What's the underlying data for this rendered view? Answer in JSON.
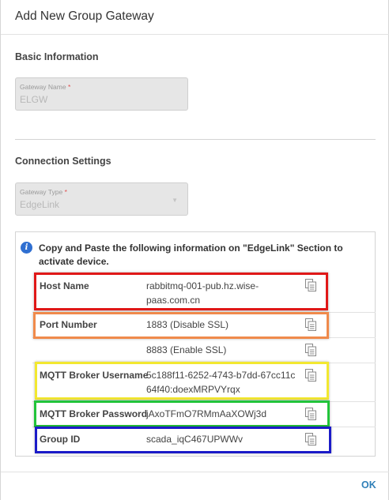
{
  "dialog": {
    "title": "Add New Group Gateway"
  },
  "basic": {
    "heading": "Basic Information",
    "gateway_name": {
      "label": "Gateway Name",
      "required": "*",
      "value": "ELGW"
    }
  },
  "connection": {
    "heading": "Connection Settings",
    "gateway_type": {
      "label": "Gateway Type",
      "required": "*",
      "value": "EdgeLink",
      "caret_icon": "caret-down-icon"
    }
  },
  "info": {
    "icon": "i",
    "message": "Copy and Paste the following information on \"EdgeLink\" Section to activate device.",
    "rows": [
      {
        "label": "Host Name",
        "value": "rabbitmq-001-pub.hz.wise-paas.com.cn",
        "highlight": "#e01818"
      },
      {
        "label": "Port Number",
        "value": "1883 (Disable SSL)",
        "highlight": "#f08a4b"
      },
      {
        "label": "",
        "value": "8883 (Enable SSL)",
        "highlight": ""
      },
      {
        "label": "MQTT Broker Username",
        "value": "5c188f11-6252-4743-b7dd-67cc11c64f40:doexMRPVYrqx",
        "highlight": "#f2e830"
      },
      {
        "label": "MQTT Broker Password",
        "value": "jAxoTFmO7RMmAaXOWj3d",
        "highlight": "#22c43a"
      },
      {
        "label": "Group ID",
        "value": "scada_iqC467UPWWv",
        "highlight": "#1b1bc8"
      }
    ]
  },
  "footer": {
    "ok_label": "OK"
  }
}
